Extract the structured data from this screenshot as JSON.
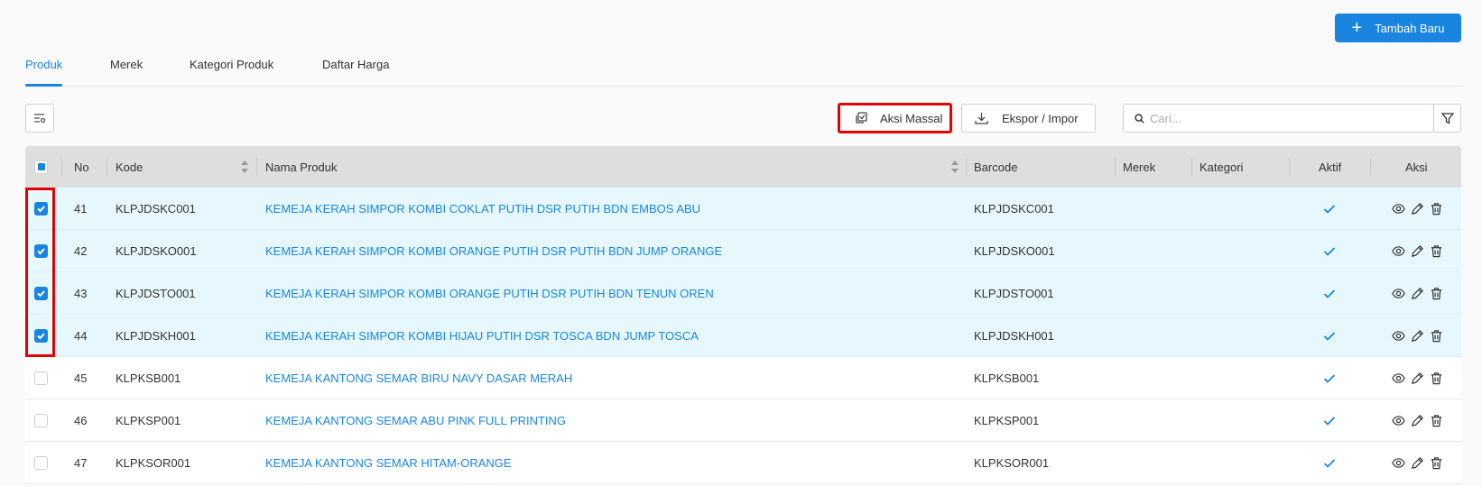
{
  "header": {
    "add_button_label": "Tambah Baru"
  },
  "tabs": [
    {
      "label": "Produk",
      "active": true
    },
    {
      "label": "Merek",
      "active": false
    },
    {
      "label": "Kategori Produk",
      "active": false
    },
    {
      "label": "Daftar Harga",
      "active": false
    }
  ],
  "toolbar": {
    "bulk_action_label": "Aksi Massal",
    "export_import_label": "Ekspor / Impor",
    "search_placeholder": "Cari..."
  },
  "table": {
    "columns": [
      "No",
      "Kode",
      "Nama Produk",
      "Barcode",
      "Merek",
      "Kategori",
      "Aktif",
      "Aksi"
    ],
    "rows": [
      {
        "checked": true,
        "no": "41",
        "kode": "KLPJDSKC001",
        "nama": "KEMEJA KERAH SIMPOR KOMBI COKLAT PUTIH DSR PUTIH BDN EMBOS ABU",
        "barcode": "KLPJDSKC001",
        "merek": "",
        "kategori": "",
        "aktif": true
      },
      {
        "checked": true,
        "no": "42",
        "kode": "KLPJDSKO001",
        "nama": "KEMEJA KERAH SIMPOR KOMBI ORANGE PUTIH DSR PUTIH BDN JUMP ORANGE",
        "barcode": "KLPJDSKO001",
        "merek": "",
        "kategori": "",
        "aktif": true
      },
      {
        "checked": true,
        "no": "43",
        "kode": "KLPJDSTO001",
        "nama": "KEMEJA KERAH SIMPOR KOMBI ORANGE PUTIH DSR PUTIH BDN TENUN OREN",
        "barcode": "KLPJDSTO001",
        "merek": "",
        "kategori": "",
        "aktif": true
      },
      {
        "checked": true,
        "no": "44",
        "kode": "KLPJDSKH001",
        "nama": "KEMEJA KERAH SIMPOR KOMBI HIJAU PUTIH DSR TOSCA BDN JUMP TOSCA",
        "barcode": "KLPJDSKH001",
        "merek": "",
        "kategori": "",
        "aktif": true
      },
      {
        "checked": false,
        "no": "45",
        "kode": "KLPKSB001",
        "nama": "KEMEJA KANTONG SEMAR BIRU NAVY DASAR MERAH",
        "barcode": "KLPKSB001",
        "merek": "",
        "kategori": "",
        "aktif": true
      },
      {
        "checked": false,
        "no": "46",
        "kode": "KLPKSP001",
        "nama": "KEMEJA KANTONG SEMAR ABU PINK FULL PRINTING",
        "barcode": "KLPKSP001",
        "merek": "",
        "kategori": "",
        "aktif": true
      },
      {
        "checked": false,
        "no": "47",
        "kode": "KLPKSOR001",
        "nama": "KEMEJA KANTONG SEMAR HITAM-ORANGE",
        "barcode": "KLPKSOR001",
        "merek": "",
        "kategori": "",
        "aktif": true
      }
    ]
  },
  "colors": {
    "primary": "#1a85e0",
    "highlight": "#e50000",
    "selected_row": "#e6f8fd",
    "header_bg": "#dedede"
  },
  "icons": {
    "add": "plus-icon",
    "columns": "column-settings-icon",
    "bulk": "bulk-select-icon",
    "export": "download-icon",
    "search": "search-icon",
    "filter": "filter-icon",
    "active": "check-icon",
    "view": "eye-icon",
    "edit": "pencil-icon",
    "delete": "trash-icon"
  }
}
